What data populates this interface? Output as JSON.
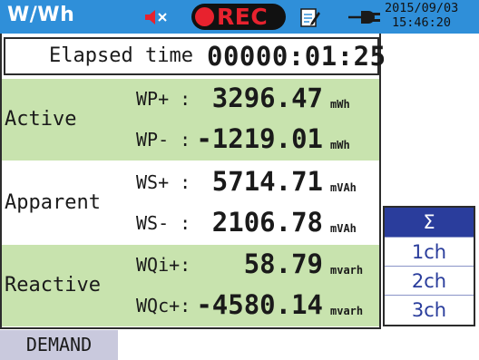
{
  "header": {
    "title": "W/Wh",
    "rec_label": "REC",
    "date": "2015/09/03",
    "time": "15:46:20",
    "icons": [
      "speaker-muted-icon",
      "record-indicator-icon",
      "memo-edit-icon",
      "power-plug-icon"
    ]
  },
  "elapsed": {
    "label": "Elapsed time",
    "value": "00000:01:25"
  },
  "groups": [
    {
      "label": "Active",
      "rows": [
        {
          "label": "WP+ :",
          "value": "3296.47",
          "unit": "mWh"
        },
        {
          "label": "WP- :",
          "value": "-1219.01",
          "unit": "mWh"
        }
      ]
    },
    {
      "label": "Apparent",
      "rows": [
        {
          "label": "WS+ :",
          "value": "5714.71",
          "unit": "mVAh"
        },
        {
          "label": "WS- :",
          "value": "2106.78",
          "unit": "mVAh"
        }
      ]
    },
    {
      "label": "Reactive",
      "rows": [
        {
          "label": "WQi+:",
          "value": "58.79",
          "unit": "mvarh"
        },
        {
          "label": "WQc+:",
          "value": "-4580.14",
          "unit": "mvarh"
        }
      ]
    }
  ],
  "channels": {
    "items": [
      "Σ",
      "1ch",
      "2ch",
      "3ch"
    ],
    "selected": "Σ"
  },
  "footer": {
    "demand_label": "DEMAND"
  },
  "colors": {
    "header_bg": "#2f8fd9",
    "rec_red": "#e8222e",
    "group_green": "#c8e3ae",
    "channel_selected": "#2a3d9c",
    "footer_button": "#c9c9dd"
  }
}
